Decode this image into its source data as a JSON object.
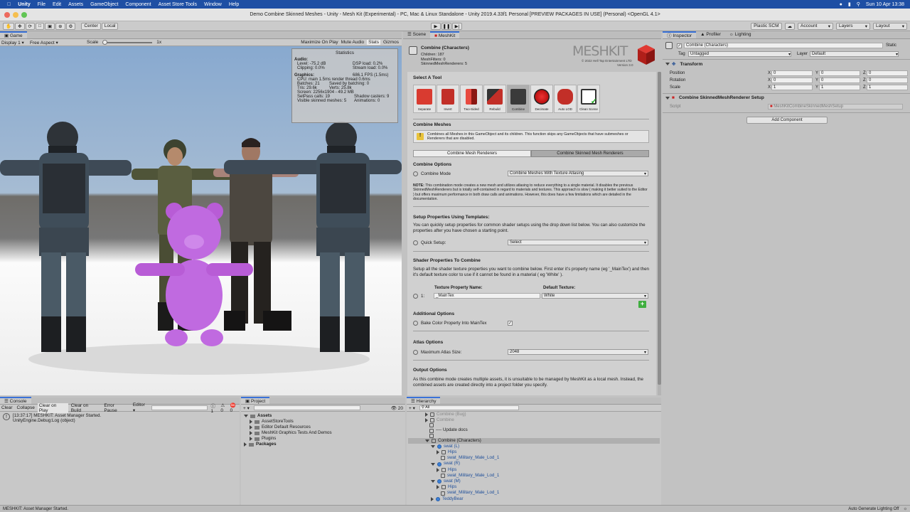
{
  "mac_menu": {
    "app_name": "Unity",
    "items": [
      "File",
      "Edit",
      "Assets",
      "GameObject",
      "Component",
      "Asset Store Tools",
      "Window",
      "Help"
    ],
    "clock": "Sun 10 Apr  13:38"
  },
  "window_title": "Demo Combine Skinned Meshes - Unity - Mesh Kit (Experimental) - PC, Mac & Linux Standalone - Unity 2019.4.33f1 Personal [PREVIEW PACKAGES IN USE] (Personal) <OpenGL 4.1>",
  "toolbar": {
    "pivot": "Center",
    "space": "Local",
    "plastic": "Plastic SCM",
    "account": "Account",
    "layers": "Layers",
    "layout": "Layout"
  },
  "game": {
    "tab": "Game",
    "display": "Display 1",
    "aspect": "Free Aspect",
    "scale_label": "Scale",
    "scale_value": "1x",
    "maximize": "Maximize On Play",
    "mute": "Mute Audio",
    "stats_btn": "Stats",
    "gizmos": "Gizmos"
  },
  "stats": {
    "title": "Statistics",
    "audio_header": "Audio:",
    "level": "Level: -75.2 dB",
    "clipping": "Clipping: 0.0%",
    "dsp": "DSP load: 0.2%",
    "stream": "Stream load: 0.0%",
    "graphics_header": "Graphics:",
    "fps": "686.1 FPS (1.5ms)",
    "cpu": "CPU: main 1.5ms  render thread 0.6ms",
    "batches": "Batches: 21",
    "saved": "Saved by batching: 0",
    "tris": "Tris: 29.6k",
    "verts": "Verts: 25.8k",
    "screen": "Screen: 2256x1904 - 49.2 MB",
    "setpass": "SetPass calls: 19",
    "shadow": "Shadow casters: 9",
    "visible": "Visible skinned meshes: 5",
    "anim": "Animations: 0"
  },
  "meshkit": {
    "tabs": [
      "Scene",
      "MeshKit"
    ],
    "object_name": "Combine (Characters)",
    "children": "Children: 187",
    "meshfilters": "MeshFilters: 0",
    "skinned": "SkinnedMeshRenderers: 5",
    "logo": "MESHKIT",
    "copyright": "© 2022 Hell Tap Entertainment LTD",
    "version": "Version 3.0",
    "select_tool": "Select A Tool",
    "tools": [
      "Separate",
      "Invert",
      "Two-Sided",
      "Rebuild",
      "Combine",
      "Decimate",
      "Auto LOD",
      "Clean Scene"
    ],
    "combine_header": "Combine Meshes",
    "combine_info": "Combines all Meshes in this GameObject and its children. This function skips any GameObjects that have submeshes or Renderers that are disabled.",
    "mode_tabs": [
      "Combine Mesh Renderers",
      "Combine Skinned Mesh Renderers"
    ],
    "combine_options": "Combine Options",
    "combine_mode_label": "Combine Mode",
    "combine_mode_value": "Combine Meshes With Texture Atlasing",
    "note_prefix": "NOTE:",
    "note": "This combination mode creates a new mesh and utilizes atlasing to reduce everything to a single material. It disables the previous SkinnedMeshRenderers but is totally self-contained in regard to materials and textures. This approach is slow ( making it better suited to the Editor ) but offers maximum performance in both draw calls and animations. However, this does have a few limitations which are detailed in the documentation.",
    "setup_header": "Setup Properties Using Templates:",
    "setup_text": "You can quickly setup properties for common shader setups using the drop down list below. You can also customize the properties after you have chosen a starting point.",
    "quick_label": "Quick Setup:",
    "quick_value": "Select",
    "shader_header": "Shader Properties To Combine",
    "shader_text": "Setup all the shader texture properties you want to combine below. First enter it's property name (eg '_MainTex') and then it's default texture color to use if it cannot be found in a material ( eg 'White' ).",
    "col_prop": "Texture Property Name:",
    "col_tex": "Default Texture:",
    "row_index": "1:",
    "prop_value": "_MainTex",
    "tex_value": "White",
    "additional_header": "Additional Options",
    "bake_label": "Bake Color Property Into MainTex",
    "atlas_header": "Atlas Options",
    "atlas_label": "Maximum Atlas Size:",
    "atlas_value": "2048",
    "output_header": "Output Options",
    "output_text": "As this combine mode creates multiple assets, it is unsuitable to be managed by MeshKit as a local mesh. Instead, the combined assets are created directly into a project folder you specify."
  },
  "inspector": {
    "tabs": [
      "Inspector",
      "Profiler",
      "Lighting"
    ],
    "name": "Combine (Characters)",
    "static": "Static",
    "tag_label": "Tag",
    "tag_value": "Untagged",
    "layer_label": "Layer",
    "layer_value": "Default",
    "transform": "Transform",
    "position": "Position",
    "rotation": "Rotation",
    "scale": "Scale",
    "pos": [
      "0",
      "0",
      "0"
    ],
    "rot": [
      "0",
      "0",
      "0"
    ],
    "scl": [
      "1",
      "1",
      "1"
    ],
    "axes": [
      "X",
      "Y",
      "Z"
    ],
    "component": "Combine SkinnedMeshRenderer Setup",
    "script_label": "Script",
    "script_value": "MeshKitCombineSkinnedMeshSetup",
    "add_component": "Add Component"
  },
  "console": {
    "tab": "Console",
    "buttons": [
      "Clear",
      "Collapse",
      "Clear on Play",
      "Clear on Build",
      "Error Pause",
      "Editor"
    ],
    "counts": [
      "1",
      "0",
      "0"
    ],
    "log_line1": "[13:37:17] MESHKIT: Asset Manager Started.",
    "log_line2": "UnityEngine.Debug:Log (object)"
  },
  "project": {
    "tab": "Project",
    "badge": "20",
    "assets": "Assets",
    "folders": [
      "AssetStoreTools",
      "Editor Default Resources",
      "MeshKit Graphics Tests And Demos",
      "Plugins"
    ],
    "packages": "Packages"
  },
  "hierarchy": {
    "tab": "Hierarchy",
    "search": "All",
    "items": [
      {
        "label": "Combine (Bug)",
        "dim": true
      },
      {
        "label": "Combine",
        "dim": true
      },
      {
        "label": "",
        "dim": true
      },
      {
        "label": "---- Update docs",
        "dim": false
      },
      {
        "label": "",
        "dim": false
      },
      {
        "label": "Combine (Characters)",
        "dim": false
      },
      {
        "label": "swat (L)",
        "dim": false
      },
      {
        "label": "Hips",
        "dim": false
      },
      {
        "label": "swat_Military_Male_Lod_1",
        "dim": false
      },
      {
        "label": "swat (R)",
        "dim": false
      },
      {
        "label": "Hips",
        "dim": false
      },
      {
        "label": "swat_Military_Male_Lod_1",
        "dim": false
      },
      {
        "label": "swat (M)",
        "dim": false
      },
      {
        "label": "Hips",
        "dim": false
      },
      {
        "label": "swat_Military_Male_Lod_1",
        "dim": false
      },
      {
        "label": "TeddyBear",
        "dim": false
      }
    ]
  },
  "status": {
    "left": "MESHKIT: Asset Manager Started.",
    "right": "Auto Generate Lighting Off"
  }
}
